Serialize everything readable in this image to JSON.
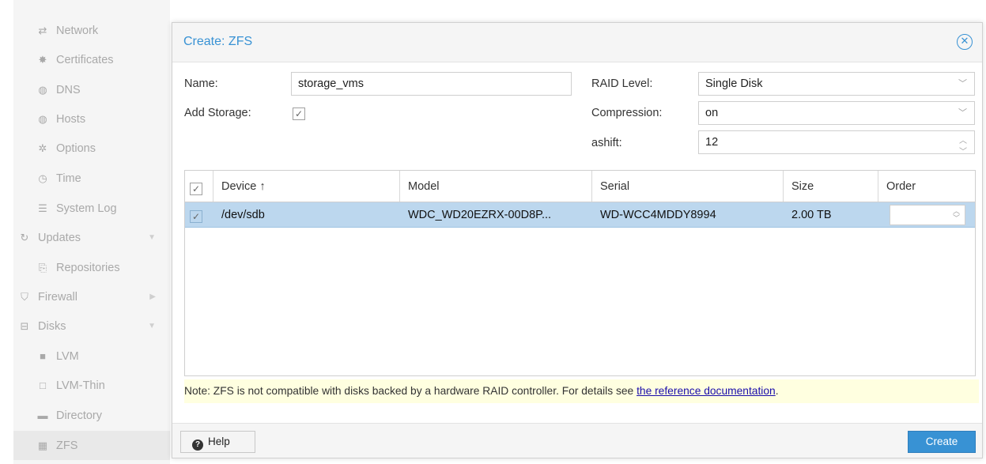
{
  "sidebar": {
    "items": [
      {
        "label": "Network",
        "icon": "network-icon",
        "glyph": "⇄"
      },
      {
        "label": "Certificates",
        "icon": "certificate-icon",
        "glyph": "✸"
      },
      {
        "label": "DNS",
        "icon": "globe-icon",
        "glyph": "◍"
      },
      {
        "label": "Hosts",
        "icon": "globe-icon",
        "glyph": "◍"
      },
      {
        "label": "Options",
        "icon": "gear-icon",
        "glyph": "✲"
      },
      {
        "label": "Time",
        "icon": "clock-icon",
        "glyph": "◷"
      },
      {
        "label": "System Log",
        "icon": "list-icon",
        "glyph": "☰"
      },
      {
        "label": "Updates",
        "icon": "refresh-icon",
        "glyph": "↻"
      },
      {
        "label": "Repositories",
        "icon": "files-icon",
        "glyph": "⎘"
      },
      {
        "label": "Firewall",
        "icon": "shield-icon",
        "glyph": "⛉"
      },
      {
        "label": "Disks",
        "icon": "hdd-icon",
        "glyph": "⊟"
      },
      {
        "label": "LVM",
        "icon": "square-icon",
        "glyph": "■"
      },
      {
        "label": "LVM-Thin",
        "icon": "square-outline-icon",
        "glyph": "□"
      },
      {
        "label": "Directory",
        "icon": "folder-icon",
        "glyph": "▬"
      },
      {
        "label": "ZFS",
        "icon": "grid-icon",
        "glyph": "▦"
      }
    ]
  },
  "dialog": {
    "title": "Create: ZFS",
    "close_glyph": "✕",
    "form": {
      "name_label": "Name:",
      "name_value": "storage_vms",
      "add_storage_label": "Add Storage:",
      "add_storage_checked": "✓",
      "raid_label": "RAID Level:",
      "raid_value": "Single Disk",
      "compression_label": "Compression:",
      "compression_value": "on",
      "ashift_label": "ashift:",
      "ashift_value": "12"
    },
    "grid": {
      "header_check": "✓",
      "columns": [
        "Device ↑",
        "Model",
        "Serial",
        "Size",
        "Order"
      ],
      "rows": [
        {
          "check": "✓",
          "device": "/dev/sdb",
          "model": "WDC_WD20EZRX-00D8P...",
          "serial": "WD-WCC4MDDY8994",
          "size": "2.00 TB",
          "order": ""
        }
      ]
    },
    "note_text": "Note: ZFS is not compatible with disks backed by a hardware RAID controller. For details see ",
    "note_link": "the reference documentation",
    "note_end": ".",
    "help_label": "Help",
    "create_label": "Create"
  },
  "colors": {
    "accent": "#3892d4",
    "selected_row": "#bcd7ee",
    "note_bg": "#ffffe0"
  }
}
